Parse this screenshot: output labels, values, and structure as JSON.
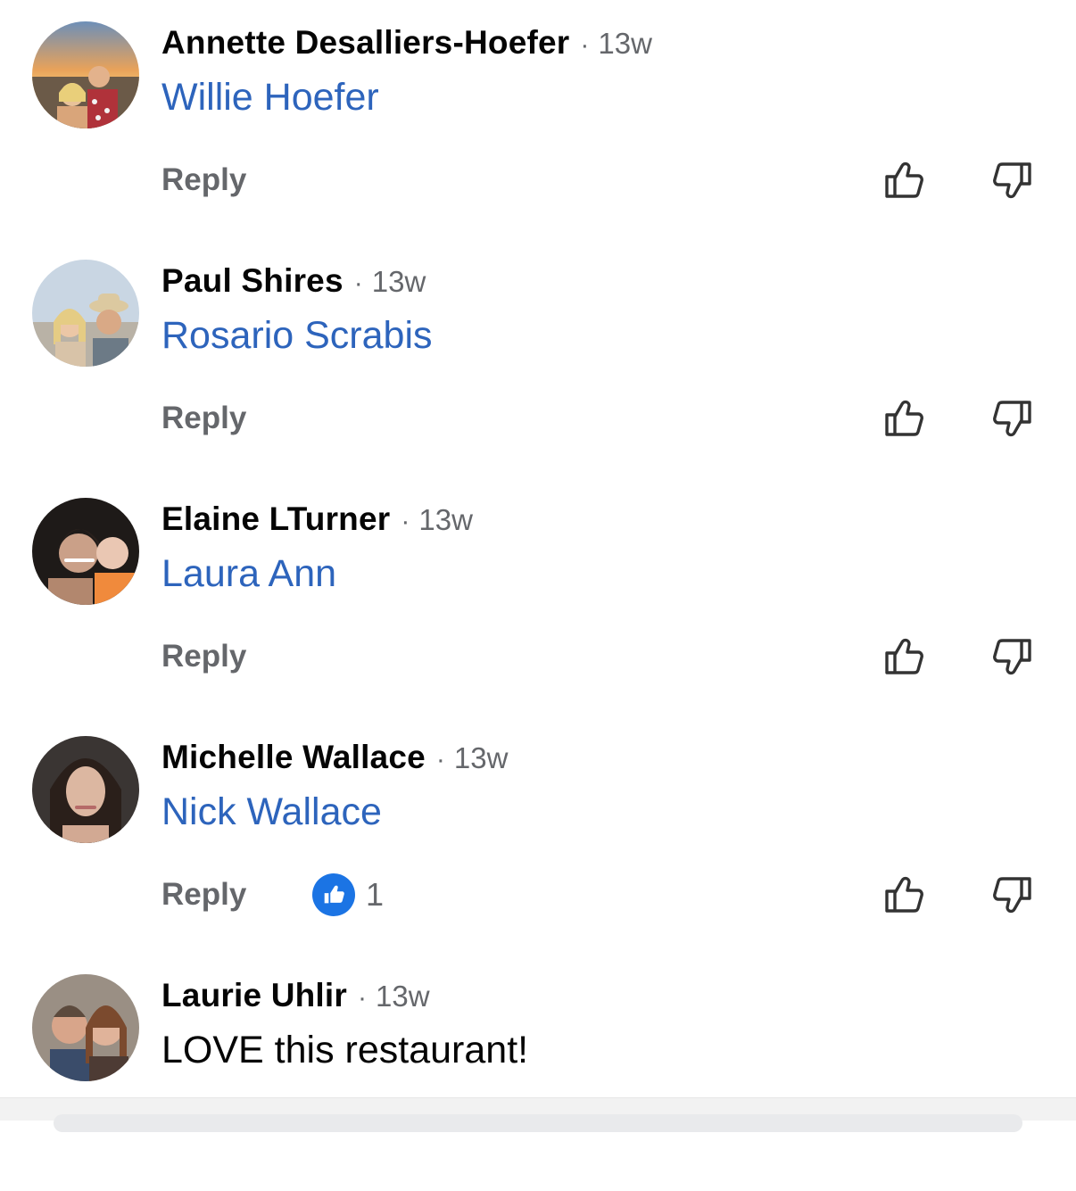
{
  "comments": [
    {
      "author": "Annette Desalliers-Hoefer",
      "time": "13w",
      "text": "Willie Hoefer",
      "reply_label": "Reply",
      "upvote_icon": "thumbs-up-outline-icon",
      "downvote_icon": "thumbs-down-outline-icon"
    },
    {
      "author": "Paul Shires",
      "time": "13w",
      "text": "Rosario Scrabis",
      "reply_label": "Reply",
      "upvote_icon": "thumbs-up-outline-icon",
      "downvote_icon": "thumbs-down-outline-icon"
    },
    {
      "author": "Elaine LTurner",
      "time": "13w",
      "text": "Laura Ann",
      "reply_label": "Reply",
      "upvote_icon": "thumbs-up-outline-icon",
      "downvote_icon": "thumbs-down-outline-icon"
    },
    {
      "author": "Michelle Wallace",
      "time": "13w",
      "text": "Nick Wallace",
      "reply_label": "Reply",
      "reaction_icon": "like-icon",
      "reaction_count": "1",
      "upvote_icon": "thumbs-up-outline-icon",
      "downvote_icon": "thumbs-down-outline-icon"
    },
    {
      "author": "Laurie Uhlir",
      "time": "13w",
      "text": "LOVE this restaurant!"
    }
  ],
  "separator": "·",
  "colors": {
    "mention": "#2d64bc",
    "secondary_text": "#65676b",
    "like_badge": "#1b74e4"
  }
}
